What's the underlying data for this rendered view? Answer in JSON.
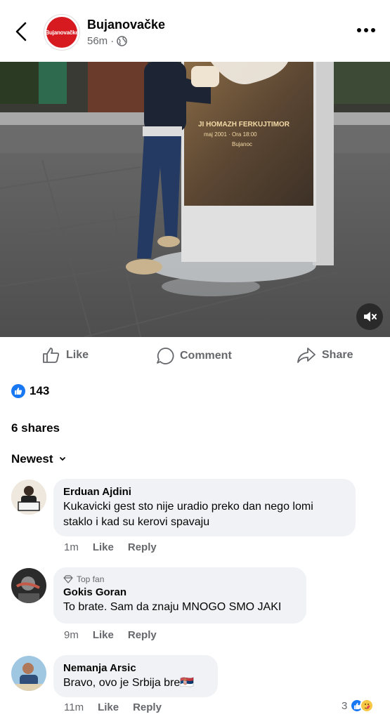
{
  "header": {
    "page_name": "Bujanovačke",
    "logo_text": "Bujanovačke",
    "time": "56m",
    "audience_icon": "globe-icon",
    "more_icon": "more-icon"
  },
  "video": {
    "sign_line_1": "JI HOMAZH FERKUJTIMOR",
    "sign_line_2": "maj 2001 · Ora 18:00",
    "sign_line_3": "Bujanoc",
    "mute_icon": "speaker-muted-icon"
  },
  "actions": {
    "like": "Like",
    "comment": "Comment",
    "share": "Share"
  },
  "stats": {
    "reactions": "143",
    "shares": "6 shares"
  },
  "sort": {
    "label": "Newest"
  },
  "comments": [
    {
      "name": "Erduan Ajdini",
      "text_line_1": "Kukavicki  gest sto nije uradio preko dan  nego lomi",
      "text_line_2": "staklo i kad su kerovi spavaju",
      "time": "1m",
      "like": "Like",
      "reply": "Reply"
    },
    {
      "badge": "Top fan",
      "name": "Gokis Goran",
      "text": "To brate. Sam da znaju MNOGO SMO JAKI",
      "time": "9m",
      "like": "Like",
      "reply": "Reply"
    },
    {
      "name": "Nemanja Arsic",
      "text": "Bravo, ovo je Srbija bre",
      "flag": "🇷🇸",
      "time": "11m",
      "like": "Like",
      "reply": "Reply",
      "reaction_count": "3"
    }
  ],
  "colors": {
    "brand_blue": "#1877f2",
    "muted_text": "#65676b",
    "bubble_bg": "#f0f2f5",
    "logo_red": "#d71920"
  }
}
